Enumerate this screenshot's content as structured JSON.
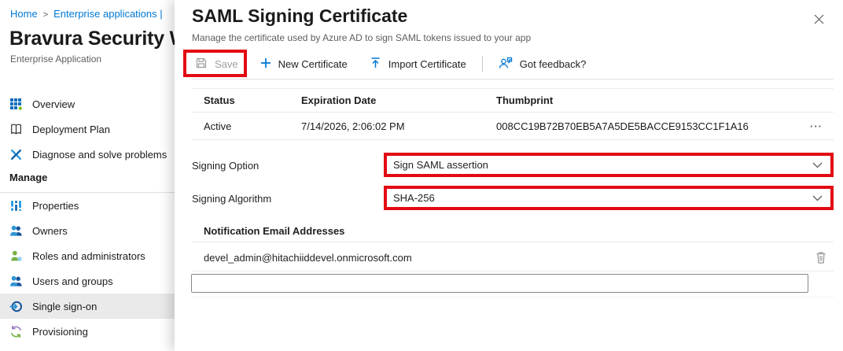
{
  "breadcrumb": {
    "home": "Home",
    "sep": ">",
    "trail": "Enterprise applications |"
  },
  "app": {
    "title": "Bravura Security W",
    "subtitle": "Enterprise Application"
  },
  "sidebar": {
    "items": [
      {
        "label": "Overview"
      },
      {
        "label": "Deployment Plan"
      },
      {
        "label": "Diagnose and solve problems"
      }
    ],
    "section": "Manage",
    "manage_items": [
      {
        "label": "Properties"
      },
      {
        "label": "Owners"
      },
      {
        "label": "Roles and administrators"
      },
      {
        "label": "Users and groups"
      },
      {
        "label": "Single sign-on",
        "selected": true
      },
      {
        "label": "Provisioning"
      }
    ]
  },
  "panel": {
    "title": "SAML Signing Certificate",
    "subtitle": "Manage the certificate used by Azure AD to sign SAML tokens issued to your app",
    "close_glyph": "✕",
    "toolbar": {
      "save": "Save",
      "new_certificate": "New Certificate",
      "import_certificate": "Import Certificate",
      "feedback": "Got feedback?"
    },
    "certificate_table": {
      "headers": {
        "status": "Status",
        "expiration": "Expiration Date",
        "thumbprint": "Thumbprint"
      },
      "row": {
        "status": "Active",
        "expiration": "7/14/2026, 2:06:02 PM",
        "thumbprint": "008CC19B72B70EB5A7A5DE5BACCE9153CC1F1A16",
        "more_glyph": "···"
      }
    },
    "signing_option": {
      "label": "Signing Option",
      "value": "Sign SAML assertion"
    },
    "signing_algorithm": {
      "label": "Signing Algorithm",
      "value": "SHA-256"
    },
    "notification": {
      "header": "Notification Email Addresses",
      "email": "devel_admin@hitachiiddevel.onmicrosoft.com",
      "new_email_value": "",
      "new_email_placeholder": ""
    }
  },
  "colors": {
    "accent": "#0078d4",
    "annotation_red": "#e30b13",
    "selected_bg": "#eaeaea"
  }
}
